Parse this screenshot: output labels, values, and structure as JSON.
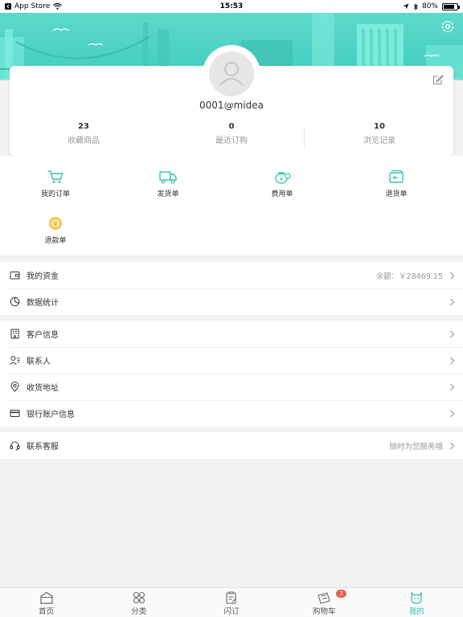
{
  "status_bar": {
    "back_app": "App Store",
    "time": "15:53",
    "battery": "80%",
    "battery_level": 0.8
  },
  "profile": {
    "username": "0001@midea",
    "stats": [
      {
        "value": "23",
        "label": "收藏商品"
      },
      {
        "value": "0",
        "label": "最近订购"
      },
      {
        "value": "10",
        "label": "浏览记录"
      }
    ]
  },
  "orders": [
    {
      "label": "我的订单",
      "icon": "cart-icon"
    },
    {
      "label": "发货单",
      "icon": "truck-icon"
    },
    {
      "label": "费用单",
      "icon": "money-bag-icon"
    },
    {
      "label": "退货单",
      "icon": "return-box-icon"
    },
    {
      "label": "退款单",
      "icon": "refund-coin-icon"
    }
  ],
  "groups": {
    "finance": {
      "funds": {
        "label": "我的资金",
        "value": "余额：￥28469.15",
        "icon": "wallet-icon"
      },
      "stats": {
        "label": "数据统计",
        "icon": "pie-chart-icon"
      }
    },
    "customer": {
      "info": {
        "label": "客户信息",
        "icon": "building-icon"
      },
      "contacts": {
        "label": "联系人",
        "icon": "contact-icon"
      },
      "address": {
        "label": "收货地址",
        "icon": "location-icon"
      },
      "bank": {
        "label": "银行账户信息",
        "icon": "card-icon"
      }
    },
    "service": {
      "support": {
        "label": "联系客服",
        "value": "随时为您服务哦",
        "icon": "headset-icon"
      }
    }
  },
  "tabs": [
    {
      "label": "首页",
      "icon": "home-icon"
    },
    {
      "label": "分类",
      "icon": "category-icon"
    },
    {
      "label": "闪订",
      "icon": "quick-order-icon"
    },
    {
      "label": "购物车",
      "icon": "shopping-cart-icon",
      "badge": "3"
    },
    {
      "label": "我的",
      "icon": "mine-icon",
      "active": true
    }
  ],
  "colors": {
    "accent": "#2fc4ae",
    "banner": "#4fd4c4",
    "badge": "#f05a4a"
  }
}
